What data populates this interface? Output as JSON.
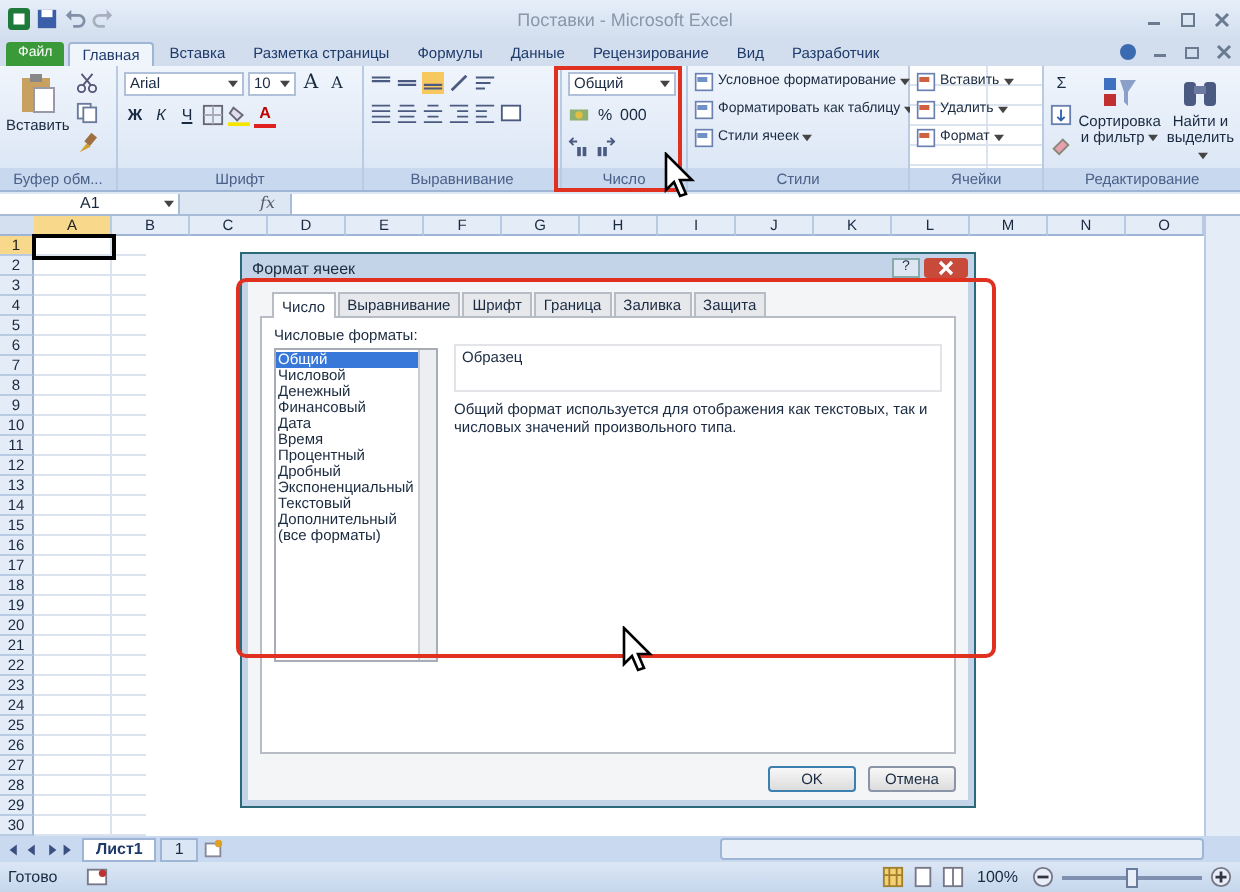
{
  "title_bar": {
    "title": "Поставки - Microsoft Excel"
  },
  "ribbon_tabs": [
    {
      "label": "Файл",
      "kind": "file",
      "selected": false
    },
    {
      "label": "Главная",
      "kind": "tab",
      "selected": true
    },
    {
      "label": "Вставка",
      "kind": "tab",
      "selected": false
    },
    {
      "label": "Разметка страницы",
      "kind": "tab",
      "selected": false
    },
    {
      "label": "Формулы",
      "kind": "tab",
      "selected": false
    },
    {
      "label": "Данные",
      "kind": "tab",
      "selected": false
    },
    {
      "label": "Рецензирование",
      "kind": "tab",
      "selected": false
    },
    {
      "label": "Вид",
      "kind": "tab",
      "selected": false
    },
    {
      "label": "Разработчик",
      "kind": "tab",
      "selected": false
    }
  ],
  "ribbon_groups": [
    {
      "kind": "clipboard",
      "label": "Буфер обм...",
      "paste": "Вставить"
    },
    {
      "kind": "font",
      "label": "Шрифт",
      "font_name": "Arial",
      "font_size": "10",
      "grow": "A",
      "shrink": "A",
      "bold": "Ж",
      "italic": "К",
      "underline": "Ч",
      "color_letter": "A"
    },
    {
      "kind": "alignment",
      "label": "Выравнивание"
    },
    {
      "kind": "number",
      "label": "Число",
      "format": "Общий",
      "percent": "%",
      "thousands": "000"
    },
    {
      "kind": "styles",
      "label": "Стили",
      "items": [
        "Условное форматирование",
        "Форматировать как таблицу",
        "Стили ячеек"
      ]
    },
    {
      "kind": "cells",
      "label": "Ячейки",
      "items": [
        "Вставить",
        "Удалить",
        "Формат"
      ]
    },
    {
      "kind": "editing",
      "label": "Редактирование",
      "sum": "Σ",
      "buttons": [
        [
          "Сортировка",
          "и фильтр"
        ],
        [
          "Найти и",
          "выделить"
        ]
      ]
    }
  ],
  "formula_bar": {
    "name_box": "A1",
    "fx": "fx"
  },
  "columns": [
    {
      "label": "A",
      "selected": true
    },
    {
      "label": "B",
      "selected": false
    },
    {
      "label": "C",
      "selected": false
    },
    {
      "label": "D",
      "selected": false
    },
    {
      "label": "E",
      "selected": false
    },
    {
      "label": "F",
      "selected": false
    },
    {
      "label": "G",
      "selected": false
    },
    {
      "label": "H",
      "selected": false
    },
    {
      "label": "I",
      "selected": false
    },
    {
      "label": "J",
      "selected": false
    },
    {
      "label": "K",
      "selected": false
    },
    {
      "label": "L",
      "selected": false
    },
    {
      "label": "M",
      "selected": false
    },
    {
      "label": "N",
      "selected": false
    },
    {
      "label": "O",
      "selected": false
    }
  ],
  "rows": [
    {
      "label": "1",
      "selected": true
    },
    {
      "label": "2",
      "selected": false
    },
    {
      "label": "3",
      "selected": false
    },
    {
      "label": "4",
      "selected": false
    },
    {
      "label": "5",
      "selected": false
    },
    {
      "label": "6",
      "selected": false
    },
    {
      "label": "7",
      "selected": false
    },
    {
      "label": "8",
      "selected": false
    },
    {
      "label": "9",
      "selected": false
    },
    {
      "label": "10",
      "selected": false
    },
    {
      "label": "11",
      "selected": false
    },
    {
      "label": "12",
      "selected": false
    },
    {
      "label": "13",
      "selected": false
    },
    {
      "label": "14",
      "selected": false
    },
    {
      "label": "15",
      "selected": false
    },
    {
      "label": "16",
      "selected": false
    },
    {
      "label": "17",
      "selected": false
    },
    {
      "label": "18",
      "selected": false
    },
    {
      "label": "19",
      "selected": false
    },
    {
      "label": "20",
      "selected": false
    },
    {
      "label": "21",
      "selected": false
    },
    {
      "label": "22",
      "selected": false
    },
    {
      "label": "23",
      "selected": false
    },
    {
      "label": "24",
      "selected": false
    },
    {
      "label": "25",
      "selected": false
    },
    {
      "label": "26",
      "selected": false
    },
    {
      "label": "27",
      "selected": false
    },
    {
      "label": "28",
      "selected": false
    },
    {
      "label": "29",
      "selected": false
    },
    {
      "label": "30",
      "selected": false
    }
  ],
  "dialog": {
    "title": "Формат ячеек",
    "help": "?",
    "tabs": [
      {
        "label": "Число",
        "selected": true
      },
      {
        "label": "Выравнивание",
        "selected": false
      },
      {
        "label": "Шрифт",
        "selected": false
      },
      {
        "label": "Граница",
        "selected": false
      },
      {
        "label": "Заливка",
        "selected": false
      },
      {
        "label": "Защита",
        "selected": false
      }
    ],
    "formats_label": "Числовые форматы:",
    "formats": [
      {
        "label": "Общий",
        "selected": true
      },
      {
        "label": "Числовой",
        "selected": false
      },
      {
        "label": "Денежный",
        "selected": false
      },
      {
        "label": "Финансовый",
        "selected": false
      },
      {
        "label": "Дата",
        "selected": false
      },
      {
        "label": "Время",
        "selected": false
      },
      {
        "label": "Процентный",
        "selected": false
      },
      {
        "label": "Дробный",
        "selected": false
      },
      {
        "label": "Экспоненциальный",
        "selected": false
      },
      {
        "label": "Текстовый",
        "selected": false
      },
      {
        "label": "Дополнительный",
        "selected": false
      },
      {
        "label": "(все форматы)",
        "selected": false
      }
    ],
    "sample_label": "Образец",
    "description": "Общий формат используется для отображения как текстовых, так и числовых значений произвольного типа.",
    "buttons": [
      "OK",
      "Отмена"
    ]
  },
  "sheet_tabs": [
    {
      "label": "Лист1",
      "selected": true
    },
    {
      "label": "1",
      "selected": false
    }
  ],
  "status_bar": {
    "status": "Готово",
    "zoom": "100%",
    "zoom_slider": {
      "level": 0.5
    }
  }
}
